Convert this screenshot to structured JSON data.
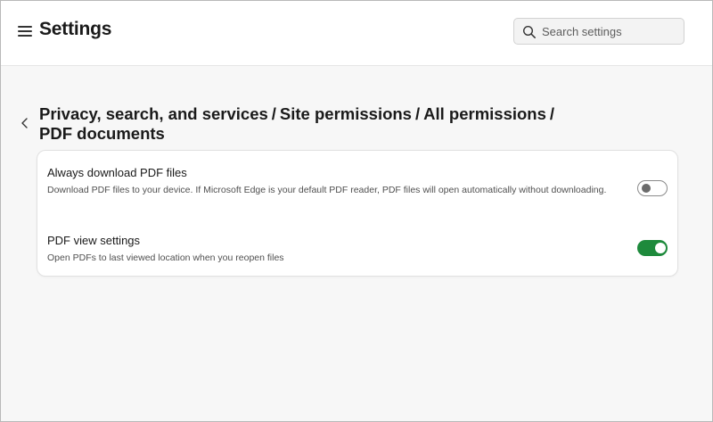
{
  "header": {
    "title": "Settings",
    "search": {
      "placeholder": "Search settings",
      "value": ""
    }
  },
  "breadcrumb": {
    "items": [
      "Privacy, search, and services",
      "Site permissions",
      "All permissions",
      "PDF documents"
    ],
    "separator": "/"
  },
  "settings": [
    {
      "title": "Always download PDF files",
      "description": "Download PDF files to your device. If Microsoft Edge is your default PDF reader, PDF files will open automatically without downloading.",
      "enabled": false
    },
    {
      "title": "PDF view settings",
      "description": "Open PDFs to last viewed location when you reopen files",
      "enabled": true
    }
  ],
  "colors": {
    "toggle_on": "#1e8a3c",
    "toggle_off_border": "#8a8a8a"
  },
  "icons": [
    "menu-icon",
    "search-icon",
    "back-chevron-icon"
  ]
}
